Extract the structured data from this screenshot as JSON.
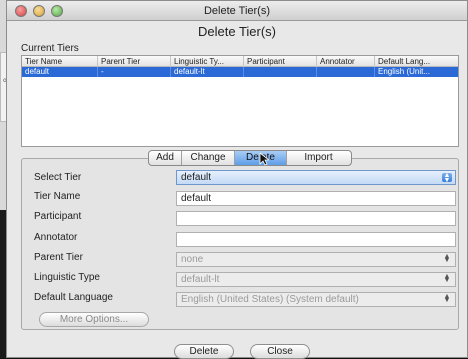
{
  "window": {
    "title": "Delete Tier(s)"
  },
  "dialog": {
    "heading": "Delete Tier(s)"
  },
  "background": {
    "strip_text": "od"
  },
  "current_tiers": {
    "label": "Current Tiers",
    "columns": [
      "Tier Name",
      "Parent Tier",
      "Linguistic Ty...",
      "Participant",
      "Annotator",
      "Default Lang..."
    ],
    "rows": [
      {
        "tier_name": "default",
        "parent_tier": "-",
        "linguistic_type": "default-lt",
        "participant": "",
        "annotator": "",
        "default_language": "English (Unit..."
      }
    ]
  },
  "tabs": {
    "add": "Add",
    "change": "Change",
    "delete": "Delete",
    "import": "Import",
    "active": "Delete"
  },
  "form": {
    "select_tier": {
      "label": "Select Tier",
      "value": "default"
    },
    "tier_name": {
      "label": "Tier Name",
      "value": "default"
    },
    "participant": {
      "label": "Participant",
      "value": ""
    },
    "annotator": {
      "label": "Annotator",
      "value": ""
    },
    "parent_tier": {
      "label": "Parent Tier",
      "value": "none"
    },
    "linguistic_type": {
      "label": "Linguistic Type",
      "value": "default-lt"
    },
    "default_language": {
      "label": "Default Language",
      "value": "English (United States) (System default)"
    },
    "more_options": "More Options..."
  },
  "buttons": {
    "delete": "Delete",
    "close": "Close"
  },
  "colors": {
    "selection": "#2a69d6",
    "active_tab": "#5f9ee8"
  }
}
